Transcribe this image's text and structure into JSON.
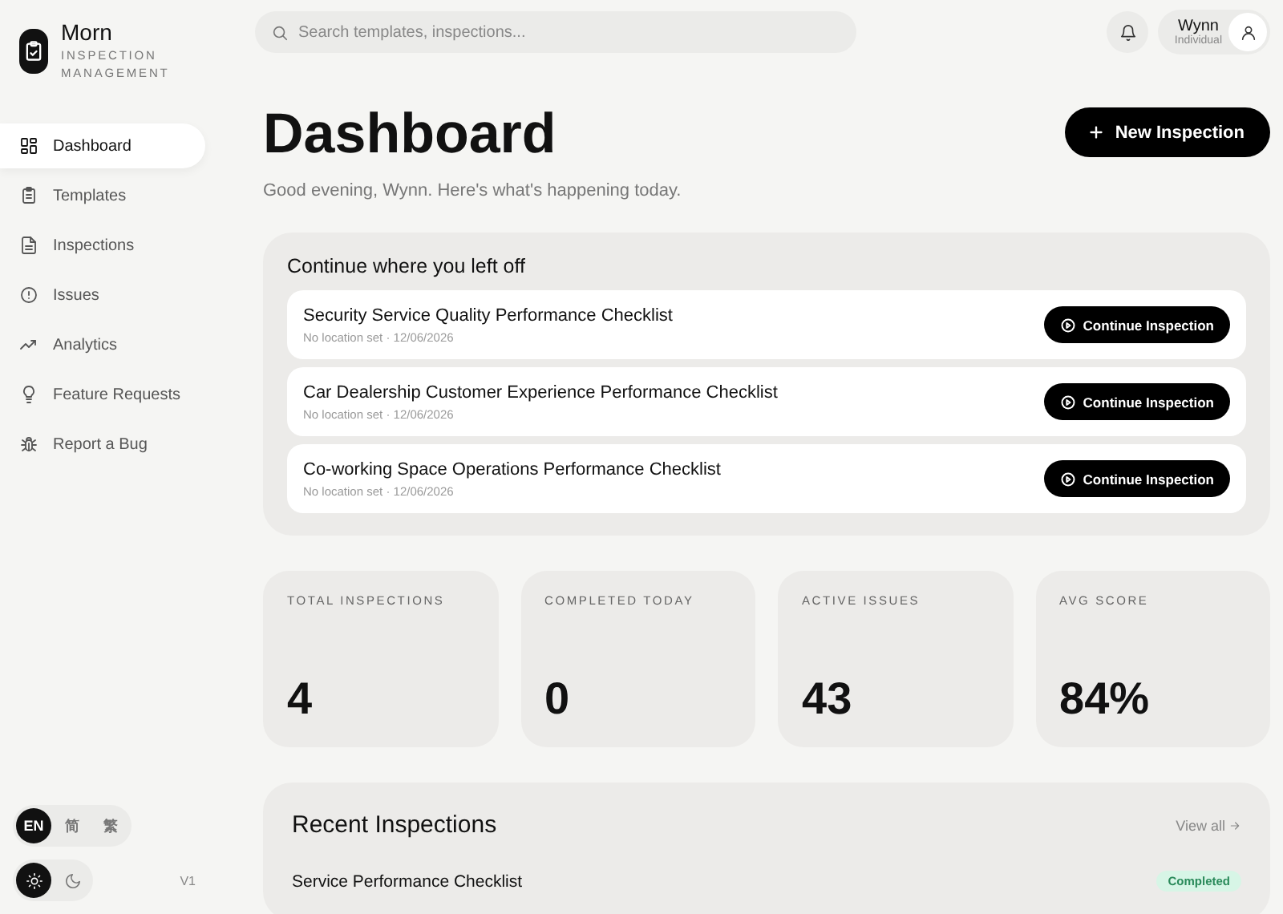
{
  "brand": {
    "name": "Morn",
    "subtitle": "INSPECTION MANAGEMENT"
  },
  "sidebar": {
    "items": [
      {
        "label": "Dashboard",
        "selected": true
      },
      {
        "label": "Templates",
        "selected": false
      },
      {
        "label": "Inspections",
        "selected": false
      },
      {
        "label": "Issues",
        "selected": false
      },
      {
        "label": "Analytics",
        "selected": false
      },
      {
        "label": "Feature Requests",
        "selected": false
      },
      {
        "label": "Report a Bug",
        "selected": false
      }
    ]
  },
  "languages": [
    {
      "label": "EN",
      "selected": true
    },
    {
      "label": "简",
      "selected": false
    },
    {
      "label": "繁",
      "selected": false
    }
  ],
  "themes": [
    {
      "selected": true
    },
    {
      "selected": false
    }
  ],
  "version": "V1",
  "search": {
    "placeholder": "Search templates, inspections..."
  },
  "user": {
    "name": "Wynn",
    "role": "Individual"
  },
  "page": {
    "title": "Dashboard",
    "subtitle": "Good evening, Wynn. Here's what's happening today.",
    "action": "New Inspection"
  },
  "continue": {
    "title": "Continue where you left off",
    "items": [
      {
        "title": "Security Service Quality Performance Checklist",
        "meta": "No location set · 12/06/2026",
        "button": "Continue Inspection"
      },
      {
        "title": "Car Dealership Customer Experience Performance Checklist",
        "meta": "No location set · 12/06/2026",
        "button": "Continue Inspection"
      },
      {
        "title": "Co-working Space Operations Performance Checklist",
        "meta": "No location set · 12/06/2026",
        "button": "Continue Inspection"
      }
    ]
  },
  "stats": [
    {
      "label": "TOTAL INSPECTIONS",
      "value": "4"
    },
    {
      "label": "COMPLETED TODAY",
      "value": "0"
    },
    {
      "label": "ACTIVE ISSUES",
      "value": "43"
    },
    {
      "label": "AVG SCORE",
      "value": "84%"
    }
  ],
  "recent": {
    "title": "Recent Inspections",
    "link": "View all",
    "rows": [
      {
        "title": "Service Performance Checklist",
        "status": "Completed",
        "color": "#d7f5e6"
      }
    ]
  }
}
